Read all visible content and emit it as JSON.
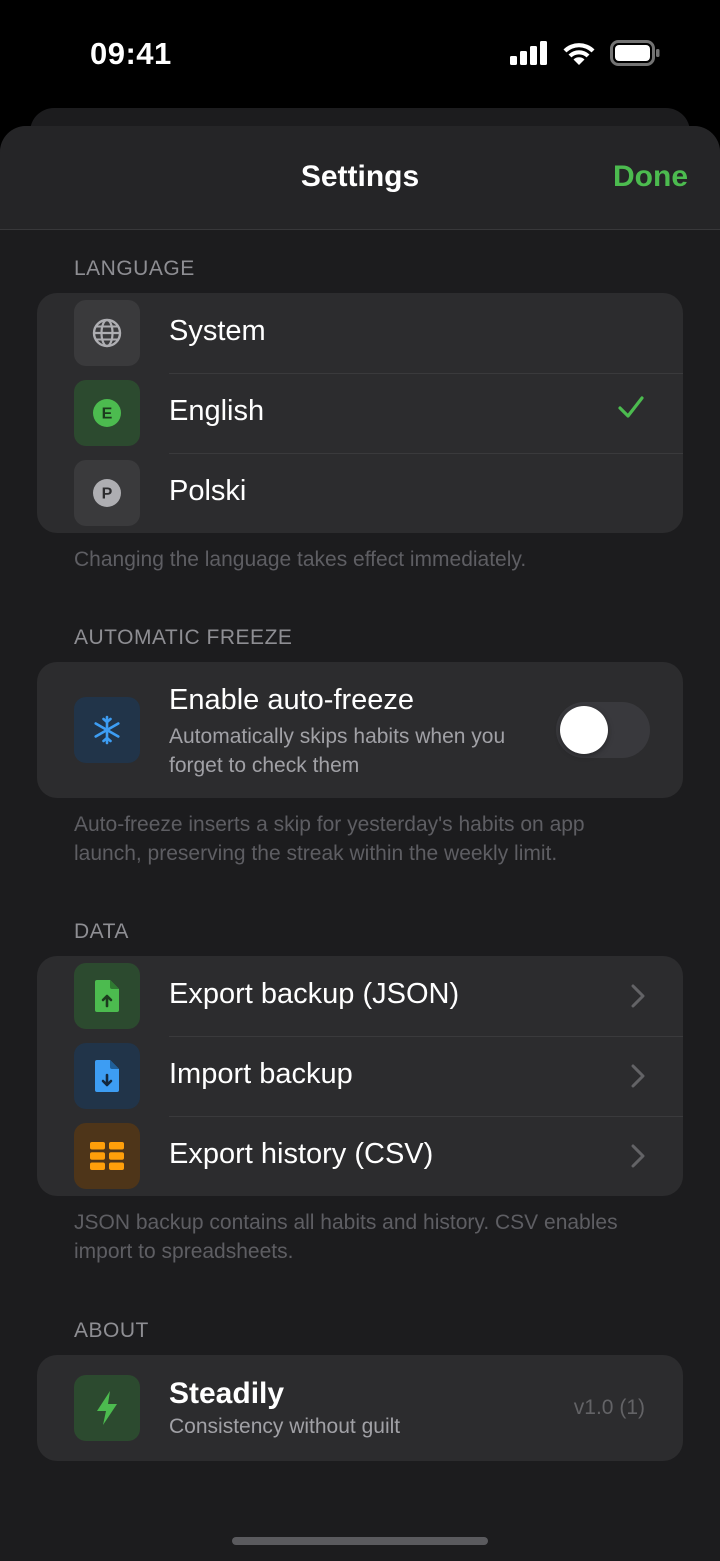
{
  "status_bar": {
    "time": "09:41",
    "icons": [
      "cellular-signal-icon",
      "wifi-icon",
      "battery-icon"
    ]
  },
  "nav": {
    "title": "Settings",
    "done_label": "Done",
    "accent_color": "#4cbb4f"
  },
  "language": {
    "header": "LANGUAGE",
    "items": [
      {
        "label": "System",
        "icon": "globe-icon",
        "selected": false
      },
      {
        "label": "English",
        "icon": "letter-e-icon",
        "selected": true
      },
      {
        "label": "Polski",
        "icon": "letter-p-icon",
        "selected": false
      }
    ],
    "footer": "Changing the language takes effect immediately."
  },
  "freeze": {
    "header": "AUTOMATIC FREEZE",
    "title": "Enable auto-freeze",
    "subtitle": "Automatically skips habits when you forget to check them",
    "icon": "snowflake-icon",
    "enabled": false,
    "footer": "Auto-freeze inserts a skip for yesterday's habits on app launch, preserving the streak within the weekly limit."
  },
  "data": {
    "header": "DATA",
    "items": [
      {
        "label": "Export backup (JSON)",
        "icon": "file-export-icon"
      },
      {
        "label": "Import backup",
        "icon": "file-import-icon"
      },
      {
        "label": "Export history (CSV)",
        "icon": "table-icon"
      }
    ],
    "footer": "JSON backup contains all habits and history. CSV enables import to spreadsheets."
  },
  "about": {
    "header": "ABOUT",
    "app_name": "Steadily",
    "tagline": "Consistency without guilt",
    "version": "v1.0 (1)",
    "icon": "bolt-icon"
  }
}
